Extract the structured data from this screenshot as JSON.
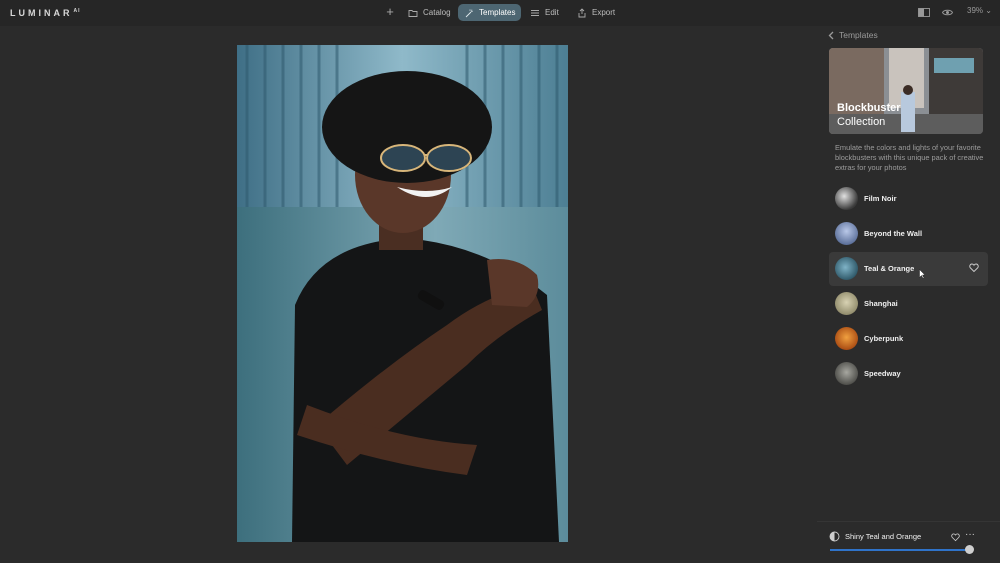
{
  "app": {
    "logo": "LUMINAR",
    "logo_sup": "AI"
  },
  "toolbar": {
    "add_symbol": "+",
    "catalog": "Catalog",
    "templates": "Templates",
    "edit": "Edit",
    "export": "Export",
    "zoom": "39%",
    "zoom_caret": "⌄"
  },
  "panel": {
    "back_label": "Templates",
    "banner": {
      "title": "Blockbuster",
      "subtitle": "Collection"
    },
    "description": "Emulate the colors and lights of your favorite blockbusters with this unique pack of creative extras for your photos",
    "templates": [
      {
        "name": "Film Noir"
      },
      {
        "name": "Beyond the Wall"
      },
      {
        "name": "Teal & Orange"
      },
      {
        "name": "Shanghai"
      },
      {
        "name": "Cyberpunk"
      },
      {
        "name": "Speedway"
      }
    ],
    "selected_template": "Teal & Orange",
    "applied": {
      "name": "Shiny Teal and Orange",
      "more": "···",
      "amount_fraction": 0.93
    }
  },
  "colors": {
    "accent_active": "#4d6672",
    "slider": "#2f73c9"
  },
  "icons": {
    "back": "chevron-left-icon",
    "catalog": "folder-icon",
    "templates": "magic-wand-icon",
    "edit": "sliders-icon",
    "export": "share-icon",
    "compare": "compare-icon",
    "preview": "eye-icon",
    "favorite": "heart-icon",
    "more": "ellipsis-icon"
  }
}
